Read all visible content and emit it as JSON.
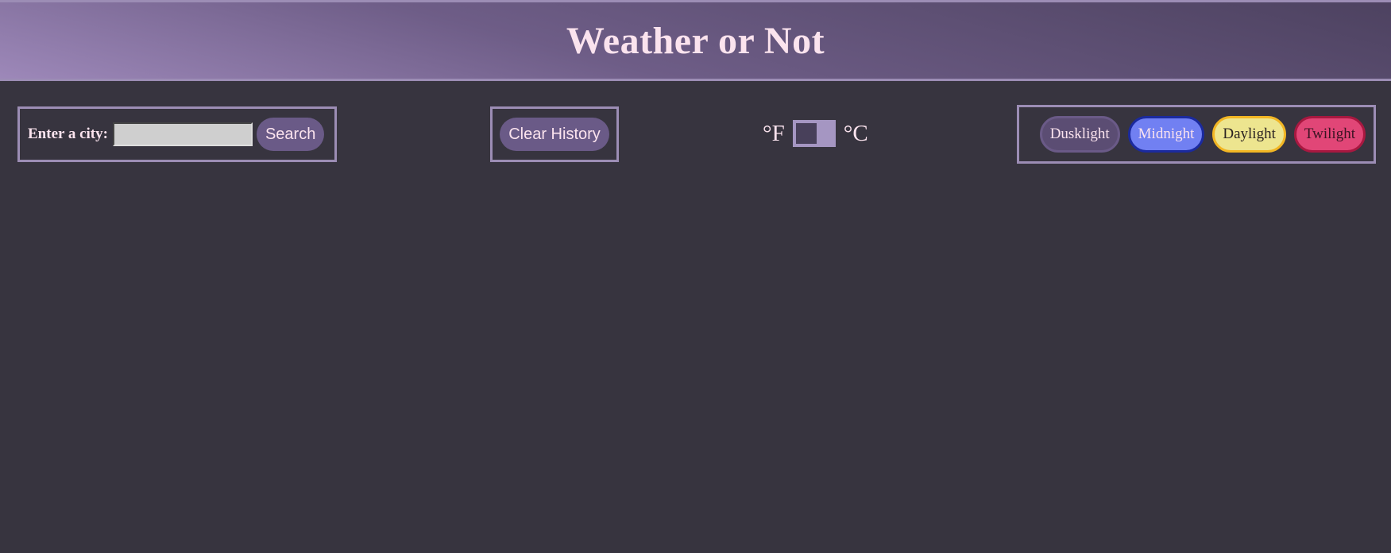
{
  "header": {
    "title": "Weather or Not"
  },
  "search": {
    "label": "Enter a city:",
    "input_value": "",
    "button_label": "Search"
  },
  "history": {
    "clear_label": "Clear History"
  },
  "units": {
    "fahrenheit_label": "°F",
    "celsius_label": "°C",
    "selected": "°F"
  },
  "themes": {
    "items": [
      {
        "label": "Dusklight",
        "color": "#5b4d73"
      },
      {
        "label": "Midnight",
        "color": "#7180f2"
      },
      {
        "label": "Daylight",
        "color": "#ede58f"
      },
      {
        "label": "Twilight",
        "color": "#e14677"
      }
    ]
  },
  "colors": {
    "background": "#37343f",
    "accent": "#9c8db5",
    "text": "#fbe3ee"
  }
}
